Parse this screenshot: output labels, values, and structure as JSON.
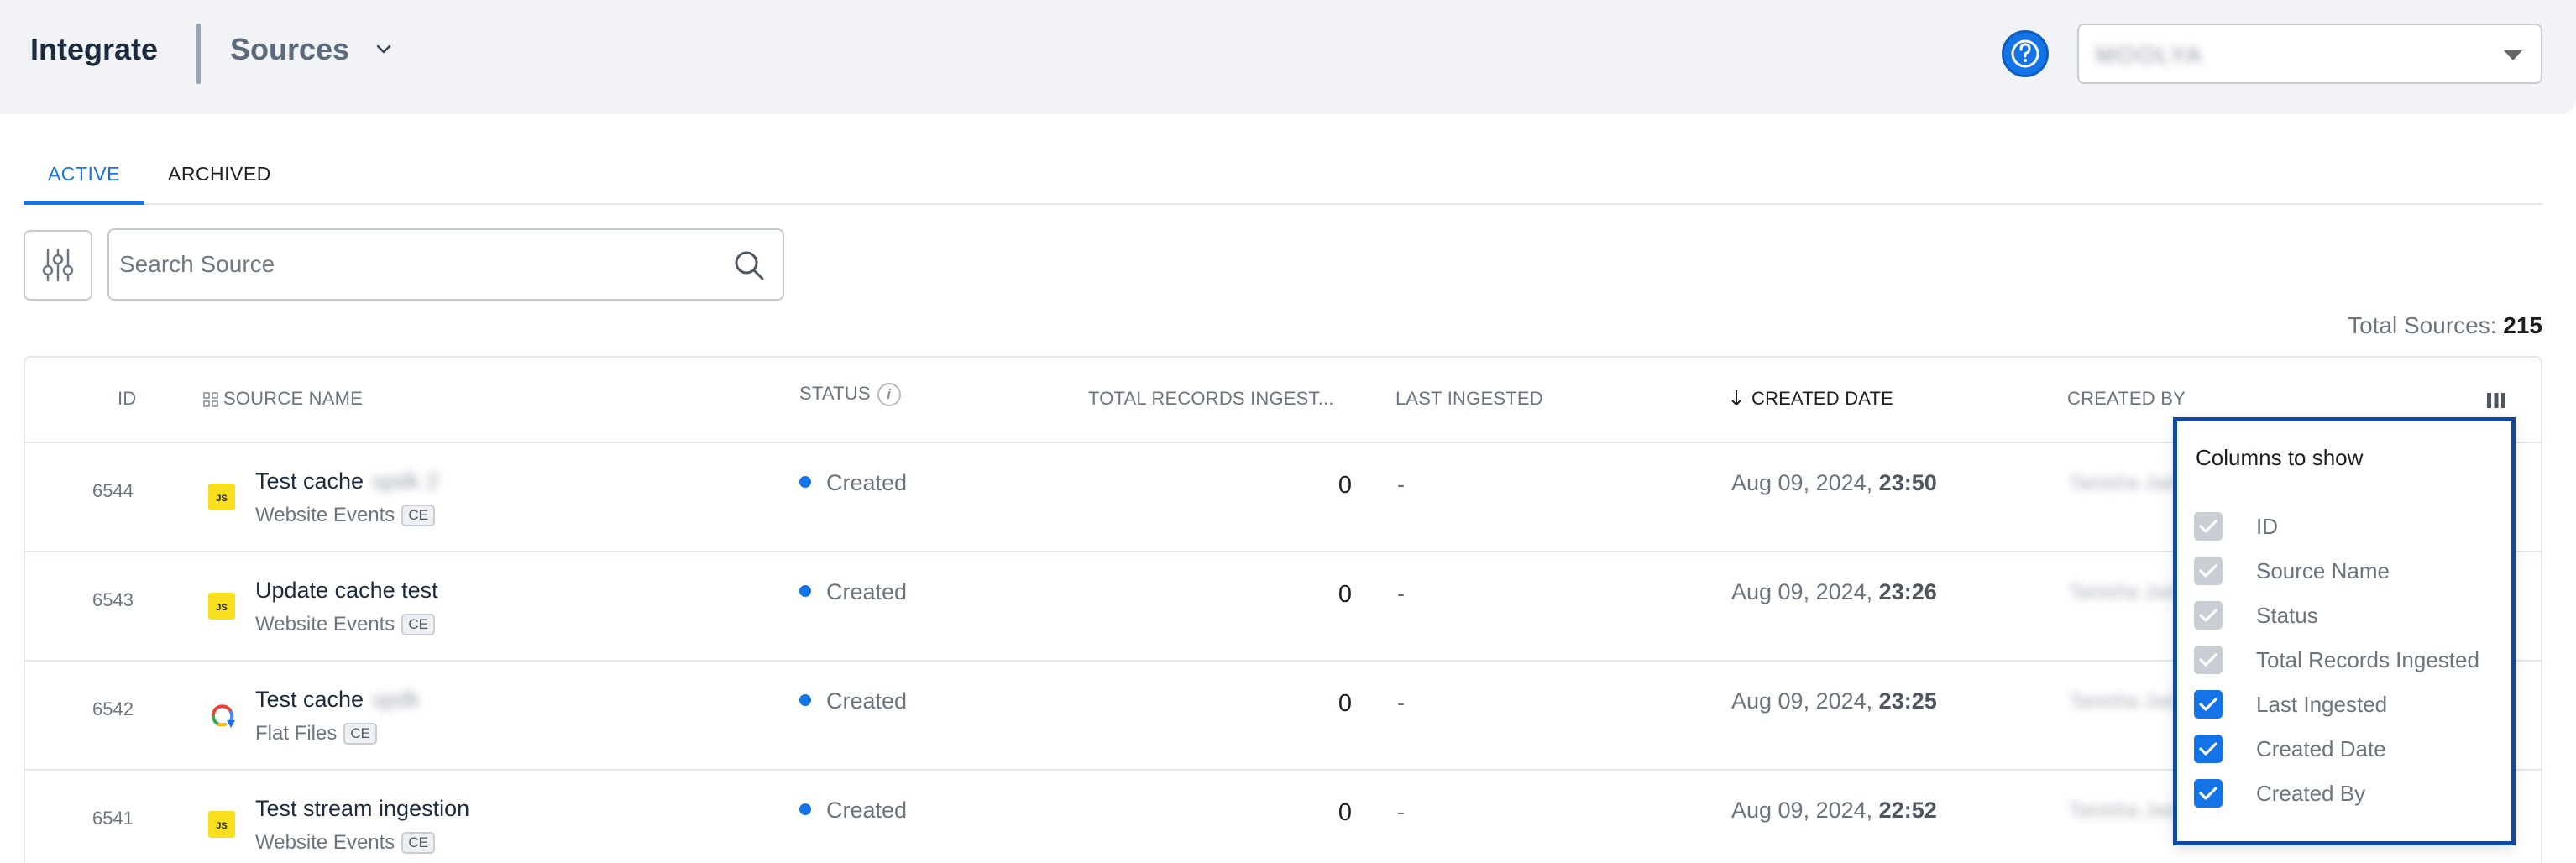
{
  "header": {
    "app_title": "Integrate",
    "section_title": "Sources",
    "org_selector_value": "MOOLYA",
    "accent_color": "#1473e6"
  },
  "tabs": [
    {
      "label": "ACTIVE",
      "active": true
    },
    {
      "label": "ARCHIVED",
      "active": false
    }
  ],
  "search": {
    "placeholder": "Search Source",
    "value": ""
  },
  "summary": {
    "total_label": "Total Sources:",
    "total_value": "215"
  },
  "table": {
    "columns": {
      "id": "ID",
      "source_name": "SOURCE NAME",
      "status": "STATUS",
      "total_records": "TOTAL RECORDS INGEST...",
      "last_ingested": "LAST INGESTED",
      "created_date": "CREATED DATE",
      "created_by": "CREATED BY"
    },
    "sort": {
      "column": "created_date",
      "direction": "desc"
    },
    "rows": [
      {
        "id": "6544",
        "icon": "js-icon",
        "name": "Test cache",
        "name_suffix": "spdk 2",
        "type": "Website Events",
        "badge": "CE",
        "status": "Created",
        "records": "0",
        "last_ingested": "-",
        "created_date": "Aug 09, 2024,",
        "created_time": "23:50",
        "created_by": "Tanisha Jain"
      },
      {
        "id": "6543",
        "icon": "js-icon",
        "name": "Update cache test",
        "name_suffix": "",
        "type": "Website Events",
        "badge": "CE",
        "status": "Created",
        "records": "0",
        "last_ingested": "-",
        "created_date": "Aug 09, 2024,",
        "created_time": "23:26",
        "created_by": "Tanisha Jain"
      },
      {
        "id": "6542",
        "icon": "google-cloud-storage-icon",
        "name": "Test cache",
        "name_suffix": "spdk",
        "type": "Flat Files",
        "badge": "CE",
        "status": "Created",
        "records": "0",
        "last_ingested": "-",
        "created_date": "Aug 09, 2024,",
        "created_time": "23:25",
        "created_by": "Tanisha Jain"
      },
      {
        "id": "6541",
        "icon": "js-icon",
        "name": "Test stream ingestion",
        "name_suffix": "",
        "type": "Website Events",
        "badge": "CE",
        "status": "Created",
        "records": "0",
        "last_ingested": "-",
        "created_date": "Aug 09, 2024,",
        "created_time": "22:52",
        "created_by": "Tanisha Jain"
      }
    ]
  },
  "column_picker": {
    "title": "Columns to show",
    "items": [
      {
        "label": "ID",
        "checked": true,
        "disabled": true
      },
      {
        "label": "Source Name",
        "checked": true,
        "disabled": true
      },
      {
        "label": "Status",
        "checked": true,
        "disabled": true
      },
      {
        "label": "Total Records Ingested",
        "checked": true,
        "disabled": true
      },
      {
        "label": "Last Ingested",
        "checked": true,
        "disabled": false
      },
      {
        "label": "Created Date",
        "checked": true,
        "disabled": false
      },
      {
        "label": "Created By",
        "checked": true,
        "disabled": false
      }
    ]
  }
}
